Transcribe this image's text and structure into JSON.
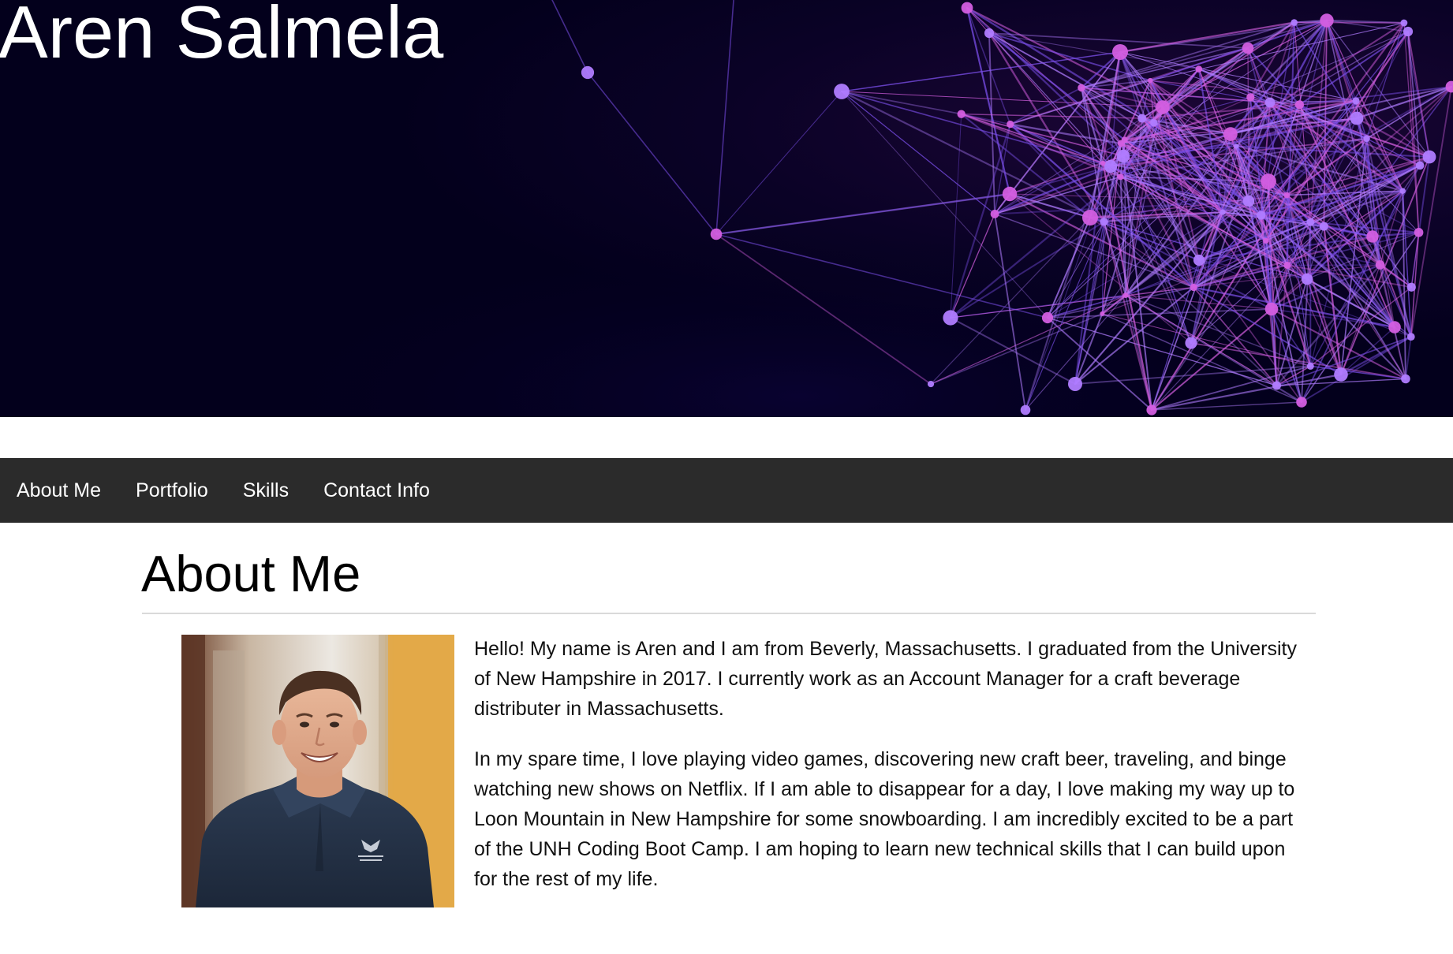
{
  "header": {
    "title": "Aren Salmela",
    "background_color": "#03001c",
    "network_colors": [
      "#b07cff",
      "#d35ee0",
      "#7a4ee8"
    ]
  },
  "nav": {
    "background_color": "#2b2b2b",
    "items": [
      {
        "label": "About Me"
      },
      {
        "label": "Portfolio"
      },
      {
        "label": "Skills"
      },
      {
        "label": "Contact Info"
      }
    ]
  },
  "about": {
    "title": "About Me",
    "photo": {
      "subject": "smiling man in navy quarter-zip sweater",
      "icon": "profile-photo"
    },
    "paragraphs": [
      "Hello! My name is Aren and I am from Beverly, Massachusetts. I graduated from the University of New Hampshire in 2017. I currently work as an Account Manager for a craft beverage distributer in Massachusetts.",
      "In my spare time, I love playing video games, discovering new craft beer, traveling, and binge watching new shows on Netflix. If I am able to disappear for a day, I love making my way up to Loon Mountain in New Hampshire for some snowboarding. I am incredibly excited to be a part of the UNH Coding Boot Camp. I am hoping to learn new technical skills that I can build upon for the rest of my life."
    ]
  }
}
